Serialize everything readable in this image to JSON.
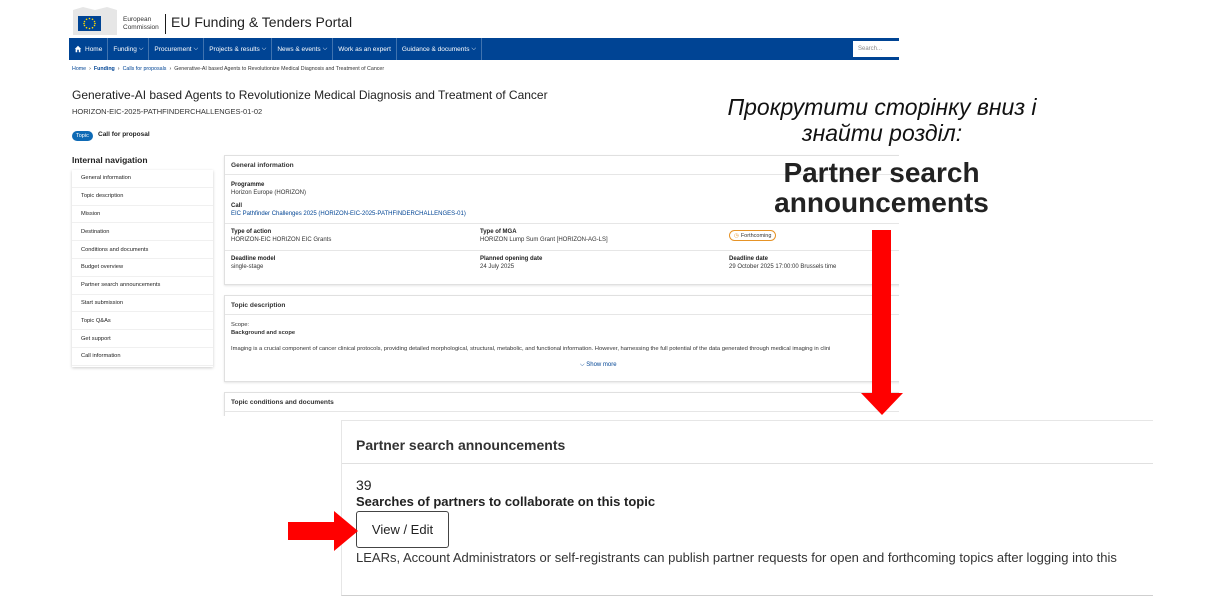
{
  "colors": {
    "nav_bg": "#004494",
    "link": "#004494",
    "badge": "#0e6ab5",
    "arrow": "#ff0000",
    "forthcoming_border": "#e69326"
  },
  "header": {
    "logo_line1": "European",
    "logo_line2": "Commission",
    "portal_name": "EU Funding & Tenders Portal"
  },
  "nav": {
    "home": "Home",
    "funding": "Funding",
    "procurement": "Procurement",
    "projects": "Projects & results",
    "news": "News & events",
    "expert": "Work as an expert",
    "guidance": "Guidance & documents",
    "search_placeholder": "Search..."
  },
  "breadcrumb": {
    "home": "Home",
    "funding": "Funding",
    "calls": "Calls for proposals",
    "current": "Generative-AI based Agents to Revolutionize Medical Diagnosis and Treatment of Cancer"
  },
  "page": {
    "title": "Generative-AI based Agents to Revolutionize Medical Diagnosis and Treatment of Cancer",
    "subtitle": "HORIZON-EIC-2025-PATHFINDERCHALLENGES-01-02",
    "badge": "Topic",
    "type": "Call for proposal"
  },
  "sidebar": {
    "title": "Internal navigation",
    "items": [
      "General information",
      "Topic description",
      "Mission",
      "Destination",
      "Conditions and documents",
      "Budget overview",
      "Partner search announcements",
      "Start submission",
      "Topic Q&As",
      "Get support",
      "Call information"
    ]
  },
  "general_info": {
    "heading": "General information",
    "programme_label": "Programme",
    "programme_value": "Horizon Europe (HORIZON)",
    "call_label": "Call",
    "call_value": "EIC Pathfinder Challenges 2025 (HORIZON-EIC-2025-PATHFINDERCHALLENGES-01)",
    "action_label": "Type of action",
    "action_value": "HORIZON-EIC HORIZON EIC Grants",
    "mga_label": "Type of MGA",
    "mga_value": "HORIZON Lump Sum Grant [HORIZON-AG-LS]",
    "status": "Forthcoming",
    "deadline_model_label": "Deadline model",
    "deadline_model_value": "single-stage",
    "opening_label": "Planned opening date",
    "opening_value": "24 July 2025",
    "deadline_label": "Deadline date",
    "deadline_value": "29 October 2025 17:00:00 Brussels time"
  },
  "topic_description": {
    "heading": "Topic description",
    "scope": "Scope:",
    "background": "Background and scope",
    "text": "Imaging is a crucial component of cancer clinical protocols, providing detailed morphological, structural, metabolic, and functional information. However, harnessing the full potential of the data generated through medical imaging in clini",
    "show_more": "Show more"
  },
  "conditions": {
    "heading": "Topic conditions and documents"
  },
  "annotation": {
    "instruction": "Прокрутити сторінку вниз і знайти розділ:",
    "target": "Partner search announcements"
  },
  "partner_search": {
    "heading": "Partner search announcements",
    "count": "39",
    "description": "Searches of partners to collaborate on this topic",
    "button": "View / Edit",
    "note": "LEARs, Account Administrators or self-registrants can publish partner requests for open and forthcoming topics after logging into this"
  }
}
